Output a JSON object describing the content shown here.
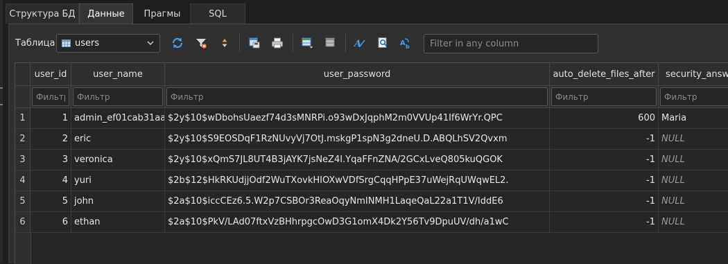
{
  "tabs": [
    {
      "label": "Структура БД"
    },
    {
      "label": "Данные"
    },
    {
      "label": "Прагмы"
    },
    {
      "label": "SQL"
    }
  ],
  "toolbar": {
    "table_label": "Таблица:",
    "table_value": "users",
    "filter_placeholder": "Filter in any column",
    "icons": [
      "refresh-icon",
      "clear-filters-icon",
      "sort-icon",
      "save-table-icon",
      "print-icon",
      "insert-record-icon",
      "delete-record-icon",
      "text-format-icon",
      "find-icon",
      "find-replace-icon"
    ]
  },
  "grid": {
    "columns": [
      {
        "label": "user_id",
        "filter": "Фильтр"
      },
      {
        "label": "user_name",
        "filter": "Фильтр"
      },
      {
        "label": "user_password",
        "filter": "Фильтр"
      },
      {
        "label": "auto_delete_files_after",
        "filter": "Фильтр"
      },
      {
        "label": "security_answer",
        "filter": "Фильтр"
      }
    ],
    "rows": [
      {
        "num": "1",
        "user_id": "1",
        "user_name": "admin_ef01cab31aa",
        "user_password": "$2y$10$wDbohsUaezf74d3sMNRPi.o93wDxJqphM2m0VVUp41If6WrYr.QPC",
        "auto_delete": "600",
        "security_answer": "Maria",
        "sa_null": false
      },
      {
        "num": "2",
        "user_id": "2",
        "user_name": "eric",
        "user_password": "$2y$10$S9EOSDqF1RzNUvyVj7OtJ.mskgP1spN3g2dneU.D.ABQLhSV2Qvxm",
        "auto_delete": "-1",
        "security_answer": "NULL",
        "sa_null": true
      },
      {
        "num": "3",
        "user_id": "3",
        "user_name": "veronica",
        "user_password": "$2y$10$xQmS7JL8UT4B3jAYK7jsNeZ4I.YqaFFnZNA/2GCxLveQ805kuQGOK",
        "auto_delete": "-1",
        "security_answer": "NULL",
        "sa_null": true
      },
      {
        "num": "4",
        "user_id": "4",
        "user_name": "yuri",
        "user_password": "$2b$12$HkRKUdjjOdf2WuTXovkHIOXwVDfSrgCqqHPpE37uWejRqUWqwEL2.",
        "auto_delete": "-1",
        "security_answer": "NULL",
        "sa_null": true
      },
      {
        "num": "5",
        "user_id": "5",
        "user_name": "john",
        "user_password": "$2a$10$iccCEz6.5.W2p7CSBOr3ReaOqyNmINMH1LaqeQaL22a1T1V/IddE6",
        "auto_delete": "-1",
        "security_answer": "NULL",
        "sa_null": true
      },
      {
        "num": "6",
        "user_id": "6",
        "user_name": "ethan",
        "user_password": "$2a$10$PkV/LAd07ftxVzBHhrpgcOwD3G1omX4Dk2Y56Tv9DpuUV/dh/a1wC",
        "auto_delete": "-1",
        "security_answer": "NULL",
        "sa_null": true
      }
    ]
  },
  "colors": {
    "accent_blue": "#4a9fe8",
    "background": "#1e1e1e",
    "panel": "#2f2f2f",
    "null_text": "#9a9a9a"
  }
}
